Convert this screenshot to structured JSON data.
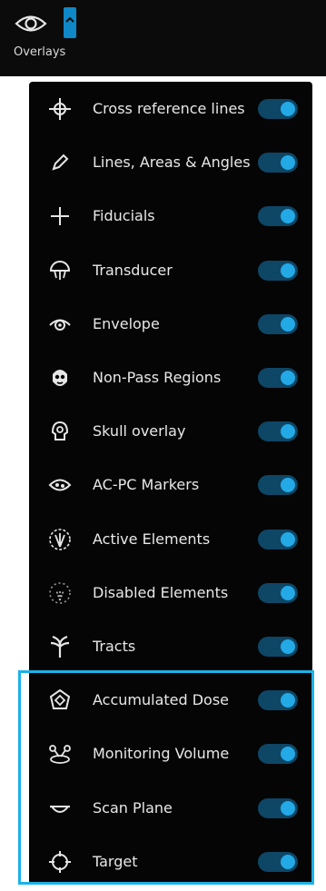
{
  "toolbar": {
    "overlays_label": "Overlays"
  },
  "overlays": [
    {
      "label": "Cross reference lines",
      "icon": "crosshair-icon",
      "on": true
    },
    {
      "label": "Lines, Areas & Angles",
      "icon": "pencil-icon",
      "on": true
    },
    {
      "label": "Fiducials",
      "icon": "plus-icon",
      "on": true
    },
    {
      "label": "Transducer",
      "icon": "transducer-icon",
      "on": true
    },
    {
      "label": "Envelope",
      "icon": "envelope-icon",
      "on": true
    },
    {
      "label": "Non-Pass Regions",
      "icon": "non-pass-regions-icon",
      "on": true
    },
    {
      "label": "Skull overlay",
      "icon": "skull-icon",
      "on": true
    },
    {
      "label": "AC-PC Markers",
      "icon": "ac-pc-markers-icon",
      "on": true
    },
    {
      "label": "Active Elements",
      "icon": "active-elements-icon",
      "on": true
    },
    {
      "label": "Disabled Elements",
      "icon": "disabled-elements-icon",
      "on": true
    },
    {
      "label": "Tracts",
      "icon": "tracts-icon",
      "on": true
    },
    {
      "label": "Accumulated Dose",
      "icon": "accumulated-dose-icon",
      "on": true
    },
    {
      "label": "Monitoring Volume",
      "icon": "monitoring-volume-icon",
      "on": true
    },
    {
      "label": "Scan Plane",
      "icon": "scan-plane-icon",
      "on": true
    },
    {
      "label": "Target",
      "icon": "target-icon",
      "on": true
    }
  ],
  "colors": {
    "accent": "#23a9e6",
    "highlight_border": "#1ab2e8",
    "toggle_track": "#0e4666",
    "panel_bg": "#050505"
  }
}
